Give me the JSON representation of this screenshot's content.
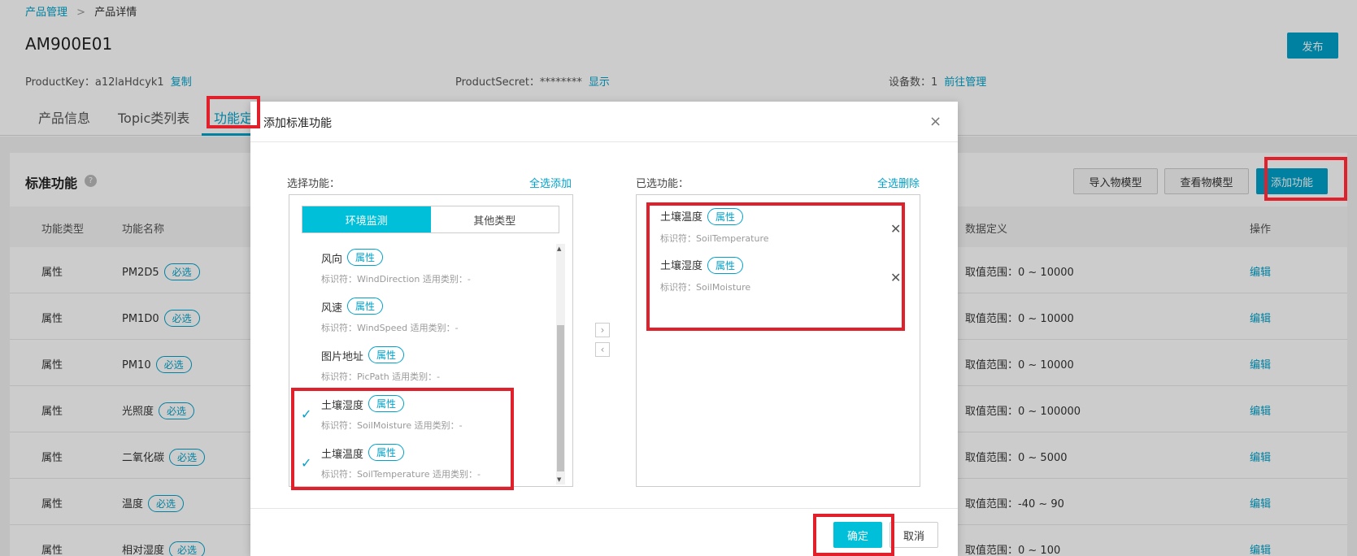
{
  "breadcrumb": {
    "root": "产品管理",
    "separator": ">",
    "current": "产品详情"
  },
  "product": {
    "name": "AM900E01",
    "publish_label": "发布",
    "productkey_label": "ProductKey：a12laHdcyk1",
    "copy_label": "复制",
    "secret_label": "ProductSecret：********",
    "show_label": "显示",
    "devices_label": "设备数：1",
    "manage_label": "前往管理"
  },
  "tabs": [
    "产品信息",
    "Topic类列表",
    "功能定"
  ],
  "standard": {
    "title": "标准功能",
    "help": "?",
    "import_label": "导入物模型",
    "view_label": "查看物模型",
    "add_label": "添加功能"
  },
  "table": {
    "headers": {
      "type": "功能类型",
      "name": "功能名称",
      "data_def": "数据定义",
      "ops": "操作"
    },
    "rows": [
      {
        "type": "属性",
        "name": "PM2D5",
        "badge": "必选",
        "range": "取值范围：0 ~ 10000",
        "op": "编辑"
      },
      {
        "type": "属性",
        "name": "PM1D0",
        "badge": "必选",
        "range": "取值范围：0 ~ 10000",
        "op": "编辑"
      },
      {
        "type": "属性",
        "name": "PM10",
        "badge": "必选",
        "range": "取值范围：0 ~ 10000",
        "op": "编辑"
      },
      {
        "type": "属性",
        "name": "光照度",
        "badge": "必选",
        "range": "取值范围：0 ~ 100000",
        "op": "编辑"
      },
      {
        "type": "属性",
        "name": "二氧化碳",
        "badge": "必选",
        "range": "取值范围：0 ~ 5000",
        "op": "编辑"
      },
      {
        "type": "属性",
        "name": "温度",
        "badge": "必选",
        "range": "取值范围：-40 ~ 90",
        "op": "编辑"
      },
      {
        "type": "属性",
        "name": "相对湿度",
        "badge": "必选",
        "range": "取值范围：0 ~ 100",
        "op": "编辑"
      }
    ]
  },
  "modal": {
    "title": "添加标准功能",
    "close": "×",
    "select_label": "选择功能：",
    "select_all": "全选添加",
    "selected_label": "已选功能：",
    "remove_all": "全选删除",
    "seg_env": "环境监测",
    "seg_other": "其他类型",
    "available": [
      {
        "name": "风向",
        "badge": "属性",
        "sub": "标识符：WindDirection   适用类别：-"
      },
      {
        "name": "风速",
        "badge": "属性",
        "sub": "标识符：WindSpeed   适用类别：-"
      },
      {
        "name": "图片地址",
        "badge": "属性",
        "sub": "标识符：PicPath   适用类别：-"
      },
      {
        "name": "土壤湿度",
        "badge": "属性",
        "sub": "标识符：SoilMoisture   适用类别：-"
      },
      {
        "name": "土壤温度",
        "badge": "属性",
        "sub": "标识符：SoilTemperature   适用类别：-"
      }
    ],
    "selected": [
      {
        "name": "土壤温度",
        "badge": "属性",
        "sub": "标识符：SoilTemperature"
      },
      {
        "name": "土壤湿度",
        "badge": "属性",
        "sub": "标识符：SoilMoisture"
      }
    ],
    "ok_label": "确定",
    "cancel_label": "取消"
  },
  "colors": {
    "accent": "#00a2ca",
    "accent_light": "#00bfd8",
    "highlight": "#e0202a"
  }
}
